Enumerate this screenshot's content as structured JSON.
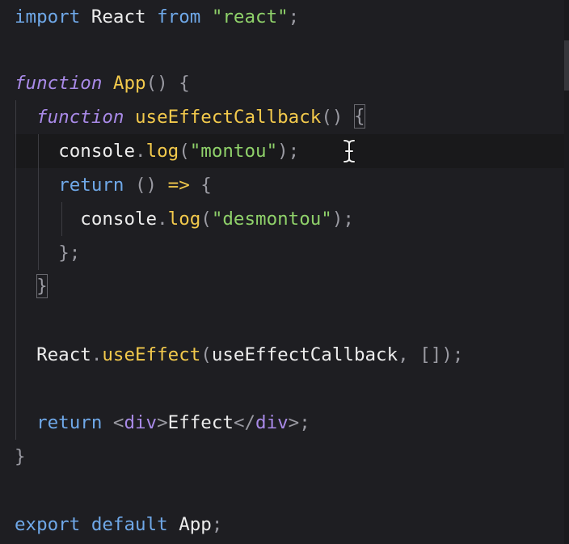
{
  "lines": {
    "l1": {
      "import": "import",
      "react": "React",
      "from": "from",
      "str": "\"react\"",
      "semi": ";"
    },
    "l3": {
      "function": "function",
      "name": "App",
      "parens": "()",
      "brace": "{"
    },
    "l4": {
      "function": "function",
      "name": "useEffectCallback",
      "parens": "()",
      "brace": "{"
    },
    "l5": {
      "console": "console",
      "dot": ".",
      "log": "log",
      "open": "(",
      "str": "\"montou\"",
      "close": ");"
    },
    "l6": {
      "return": "return",
      "parens": "()",
      "arrow": "=>",
      "brace": "{"
    },
    "l7": {
      "console": "console",
      "dot": ".",
      "log": "log",
      "open": "(",
      "str": "\"desmontou\"",
      "close": ");"
    },
    "l8": {
      "close": "};"
    },
    "l9": {
      "close": "}"
    },
    "l11": {
      "react": "React",
      "dot": ".",
      "useEffect": "useEffect",
      "open": "(",
      "arg": "useEffectCallback",
      "comma": ",",
      "arr": "[]",
      "close": ");"
    },
    "l13": {
      "return": "return",
      "lt": "<",
      "tag1": "div",
      "gt": ">",
      "text": "Effect",
      "lt2": "</",
      "tag2": "div",
      "gt2": ">",
      "semi": ";"
    },
    "l14": {
      "close": "}"
    },
    "l16": {
      "export": "export",
      "default": "default",
      "app": "App",
      "semi": ";"
    }
  },
  "colors": {
    "background": "#1e1e22",
    "keyword": "#6fa8e8",
    "function_keyword": "#a98ae8",
    "function_name": "#f2c94c",
    "string": "#8fd16a",
    "punctuation": "#9a9aa2"
  },
  "icons": {
    "cursor": "text-cursor-icon"
  }
}
